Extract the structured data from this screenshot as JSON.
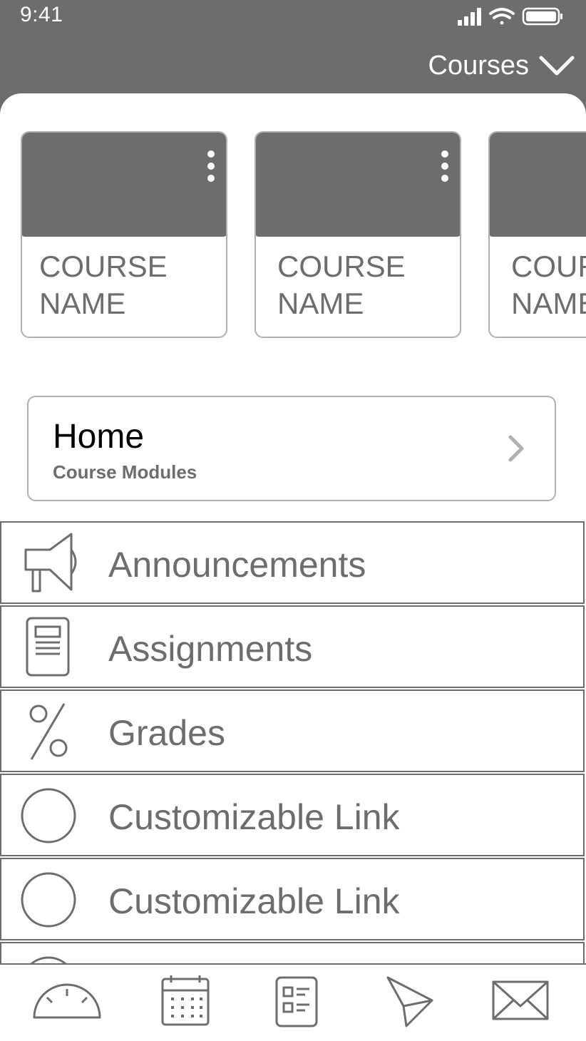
{
  "status_bar": {
    "time": "9:41"
  },
  "header": {
    "title": "Courses"
  },
  "course_cards": [
    {
      "name": "COURSE NAME"
    },
    {
      "name": "COURSE NAME"
    },
    {
      "name": "COURSE NAME"
    }
  ],
  "home": {
    "title": "Home",
    "subtitle": "Course Modules"
  },
  "nav_items": [
    {
      "label": "Announcements",
      "icon": "megaphone-icon"
    },
    {
      "label": "Assignments",
      "icon": "document-icon"
    },
    {
      "label": "Grades",
      "icon": "percent-icon"
    },
    {
      "label": "Customizable Link",
      "icon": "circle-icon"
    },
    {
      "label": "Customizable Link",
      "icon": "circle-icon"
    }
  ],
  "tab_bar": [
    {
      "icon": "dashboard-icon"
    },
    {
      "icon": "calendar-icon"
    },
    {
      "icon": "todo-list-icon"
    },
    {
      "icon": "send-icon"
    },
    {
      "icon": "mail-icon"
    }
  ],
  "colors": {
    "primary": "#6d6d6d",
    "border": "#b0b0b0",
    "background": "#ffffff"
  }
}
